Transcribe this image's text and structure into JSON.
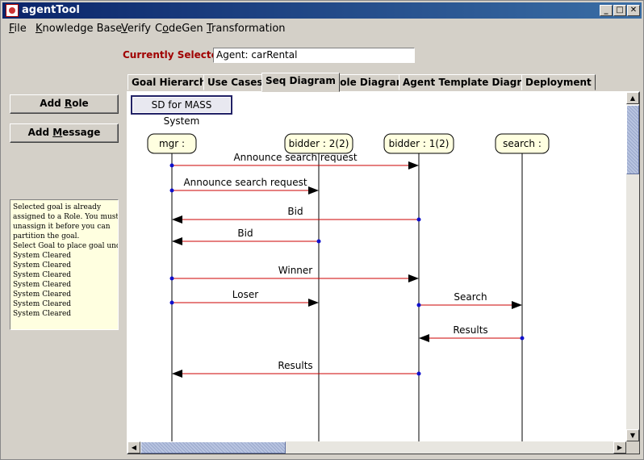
{
  "window": {
    "title": "agentTool"
  },
  "menu": [
    {
      "pre": "",
      "u": "F",
      "post": "ile"
    },
    {
      "pre": "",
      "u": "K",
      "post": "nowledge Base"
    },
    {
      "pre": "",
      "u": "V",
      "post": "erify"
    },
    {
      "pre": "C",
      "u": "o",
      "post": "deGen"
    },
    {
      "pre": "",
      "u": "T",
      "post": "ransformation"
    }
  ],
  "selection": {
    "label": "Currently Selected",
    "value": "Agent: carRental"
  },
  "buttons": {
    "add_role": {
      "pre": "Add ",
      "u": "R",
      "post": "ole"
    },
    "add_message": {
      "pre": "Add ",
      "u": "M",
      "post": "essage"
    }
  },
  "log": [
    "   Selected goal is already",
    "assigned to a Role.  You must",
    "unassign it before you can",
    "partition the goal.",
    "Select Goal to place goal under",
    "System Cleared",
    "System Cleared",
    "System Cleared",
    "System Cleared",
    "System Cleared",
    "System Cleared",
    "System Cleared"
  ],
  "tabs": [
    {
      "label": "Goal Hierarchy",
      "active": false
    },
    {
      "label": "Use Cases",
      "active": false
    },
    {
      "label": "Seq Diagram",
      "active": true
    },
    {
      "label": "Role Diagram",
      "active": false
    },
    {
      "label": "Agent Template Diagram",
      "active": false
    },
    {
      "label": "Deployment",
      "active": false
    }
  ],
  "diagram": {
    "title": "SD for MASS System",
    "lifelines": [
      {
        "id": "mgr",
        "label": "mgr :"
      },
      {
        "id": "bidder2",
        "label": "bidder : 2(2)"
      },
      {
        "id": "bidder1",
        "label": "bidder : 1(2)"
      },
      {
        "id": "search",
        "label": "search :"
      }
    ],
    "messages": [
      {
        "label": "Announce search request",
        "from": "mgr",
        "to": "bidder1"
      },
      {
        "label": "Announce search request",
        "from": "mgr",
        "to": "bidder2"
      },
      {
        "label": "Bid",
        "from": "bidder1",
        "to": "mgr"
      },
      {
        "label": "Bid",
        "from": "bidder2",
        "to": "mgr"
      },
      {
        "label": "Winner",
        "from": "mgr",
        "to": "bidder1"
      },
      {
        "label": "Loser",
        "from": "mgr",
        "to": "bidder2"
      },
      {
        "label": "Search",
        "from": "bidder1",
        "to": "search"
      },
      {
        "label": "Results",
        "from": "search",
        "to": "bidder1"
      },
      {
        "label": "Results",
        "from": "bidder1",
        "to": "mgr"
      }
    ]
  },
  "colors": {
    "message_line": "#cc0000",
    "lifeline_box": "#ffffe0",
    "title_bar": "#0a246a",
    "selected_label": "#a00000"
  }
}
